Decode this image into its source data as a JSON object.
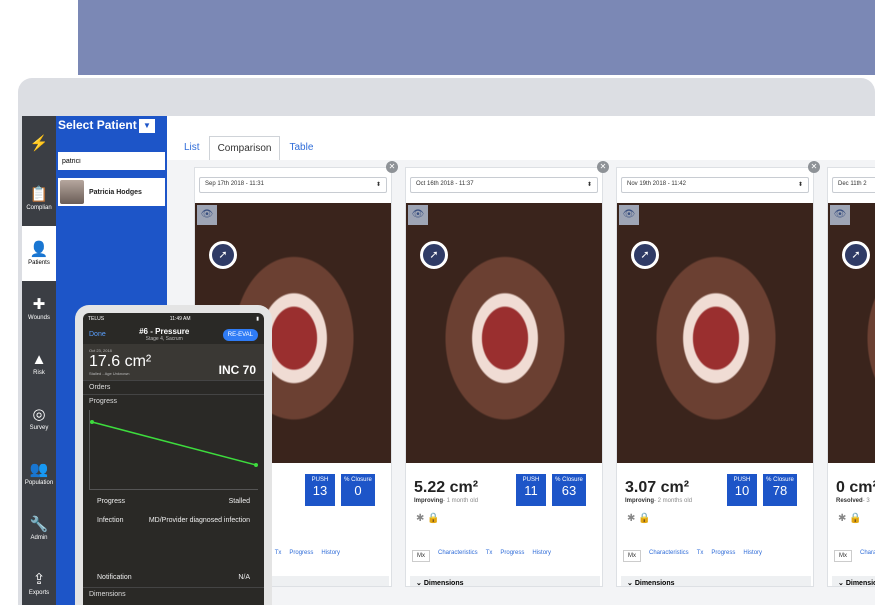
{
  "sidebar": [
    {
      "icon": "lightning-icon",
      "label": ""
    },
    {
      "icon": "clipboard-icon",
      "label": "Complian"
    },
    {
      "icon": "person-icon",
      "label": "Patients"
    },
    {
      "icon": "plus-icon",
      "label": "Wounds"
    },
    {
      "icon": "warning-icon",
      "label": "Risk"
    },
    {
      "icon": "survey-icon",
      "label": "Survey"
    },
    {
      "icon": "population-icon",
      "label": "Population"
    },
    {
      "icon": "wrench-icon",
      "label": "Admin"
    },
    {
      "icon": "export-icon",
      "label": "Exports"
    }
  ],
  "patient_panel": {
    "title": "Select Patient",
    "search_value": "patrici",
    "patient": "Patricia Hodges"
  },
  "tabs": [
    "List",
    "Comparison",
    "Table"
  ],
  "cards": [
    {
      "date": "Sep 17th 2018 - 11:31",
      "area": "",
      "status": "",
      "age": "",
      "push": "13",
      "closure": "0"
    },
    {
      "date": "Oct 16th 2018 - 11:37",
      "area": "5.22 cm²",
      "status": "Improving",
      "age": "- 1 month old",
      "push": "11",
      "closure": "63"
    },
    {
      "date": "Nov 19th 2018 - 11:42",
      "area": "3.07 cm²",
      "status": "Improving",
      "age": "- 2 months old",
      "push": "10",
      "closure": "78"
    },
    {
      "date": "Dec 11th 2",
      "area": "0 cm²",
      "status": "Resolved",
      "age": "- 3",
      "push": "",
      "closure": ""
    }
  ],
  "card_labels": {
    "push": "PUSH",
    "closure": "% Closure",
    "dims": "Dimensions"
  },
  "card_tabs": [
    "Mx",
    "Characteristics",
    "Tx",
    "Progress",
    "History"
  ],
  "phone": {
    "carrier": "TELUS",
    "time": "11:49 AM",
    "done": "Done",
    "wound_title": "#6 - Pressure",
    "wound_sub": "Stage 4, Sacrum",
    "reeval": "RE-EVAL",
    "date": "Oct 23, 2018",
    "area": "17.6 cm²",
    "inc": "INC 70",
    "stalled_text": "Stalled - Age Unknown",
    "orders": "Orders",
    "progress": "Progress",
    "progress_value": "Stalled",
    "infection": "Infection",
    "infection_value": "MD/Provider diagnosed infection",
    "notification": "Notification",
    "notification_value": "N/A",
    "dimensions": "Dimensions"
  }
}
